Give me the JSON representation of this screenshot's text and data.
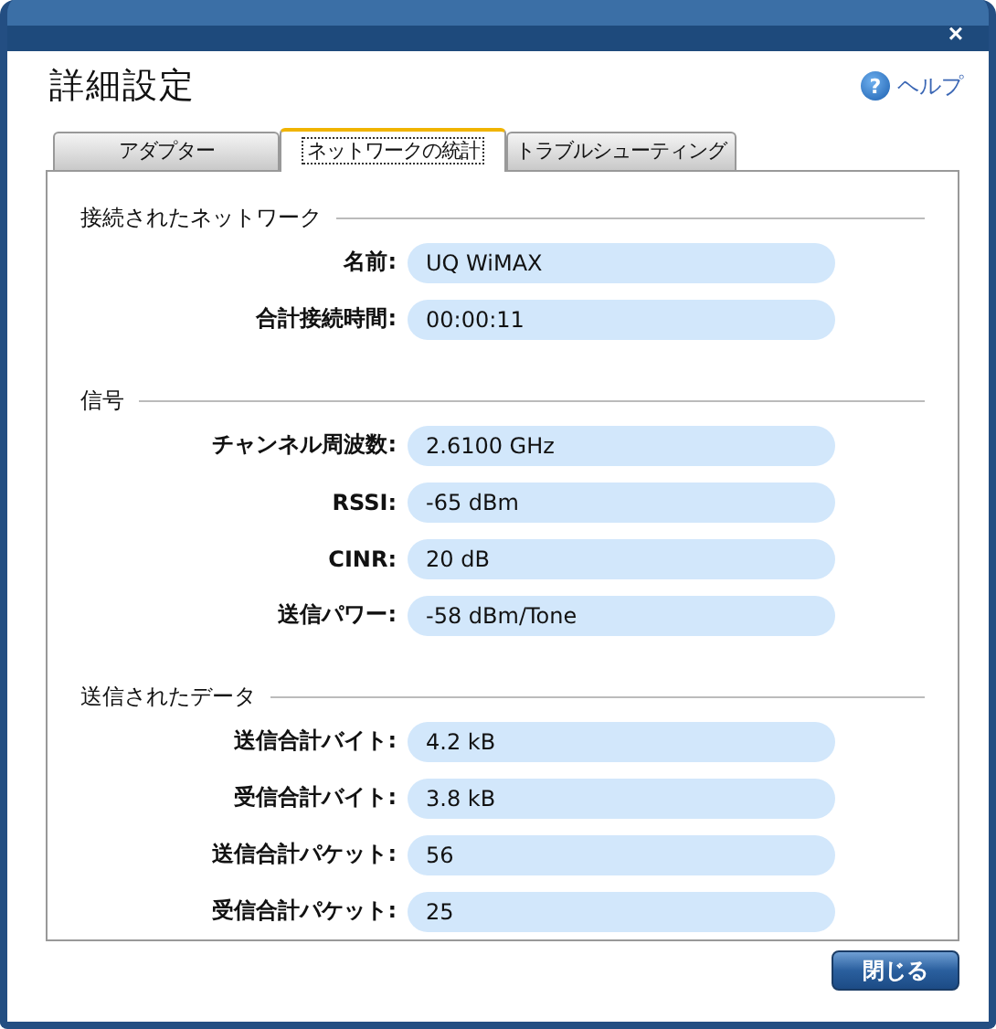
{
  "window": {
    "close": "×"
  },
  "title": "詳細設定",
  "help": {
    "icon": "?",
    "label": "ヘルプ"
  },
  "tabs": [
    {
      "label": "アダプター",
      "selected": false
    },
    {
      "label": "ネットワークの統計",
      "selected": true
    },
    {
      "label": "トラブルシューティング",
      "selected": false
    }
  ],
  "sections": [
    {
      "title": "接続されたネットワーク",
      "rows": [
        {
          "label": "名前:",
          "value": "UQ WiMAX"
        },
        {
          "label": "合計接続時間:",
          "value": "00:00:11"
        }
      ]
    },
    {
      "title": "信号",
      "rows": [
        {
          "label": "チャンネル周波数:",
          "value": "2.6100 GHz"
        },
        {
          "label": "RSSI:",
          "value": "-65 dBm"
        },
        {
          "label": "CINR:",
          "value": "20 dB"
        },
        {
          "label": "送信パワー:",
          "value": "-58 dBm/Tone"
        }
      ]
    },
    {
      "title": "送信されたデータ",
      "rows": [
        {
          "label": "送信合計バイト:",
          "value": "4.2 kB"
        },
        {
          "label": "受信合計バイト:",
          "value": "3.8 kB"
        },
        {
          "label": "送信合計パケット:",
          "value": "56"
        },
        {
          "label": "受信合計パケット:",
          "value": "25"
        }
      ]
    }
  ],
  "buttons": [
    "閉じる"
  ]
}
